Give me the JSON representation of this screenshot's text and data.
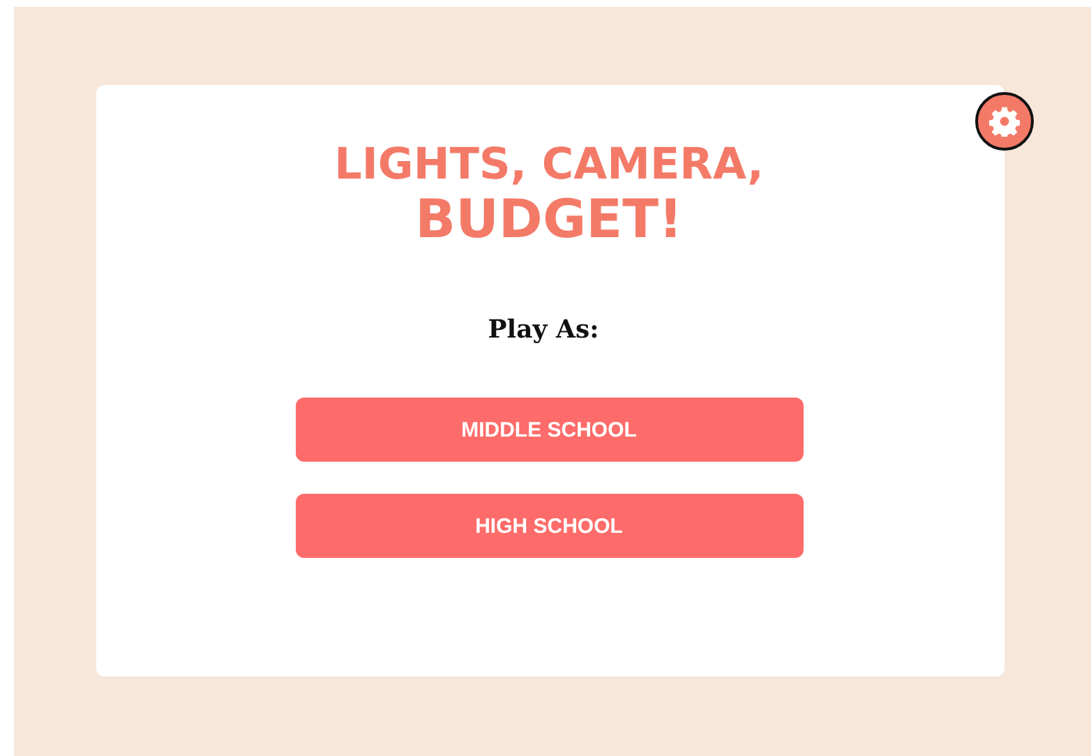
{
  "title_lines": [
    "LIGHTS, CAMERA,",
    "BUDGET!"
  ],
  "prompt": "Play As:",
  "buttons": [
    {
      "label": "MIDDLE SCHOOL"
    },
    {
      "label": "HIGH SCHOOL"
    }
  ]
}
